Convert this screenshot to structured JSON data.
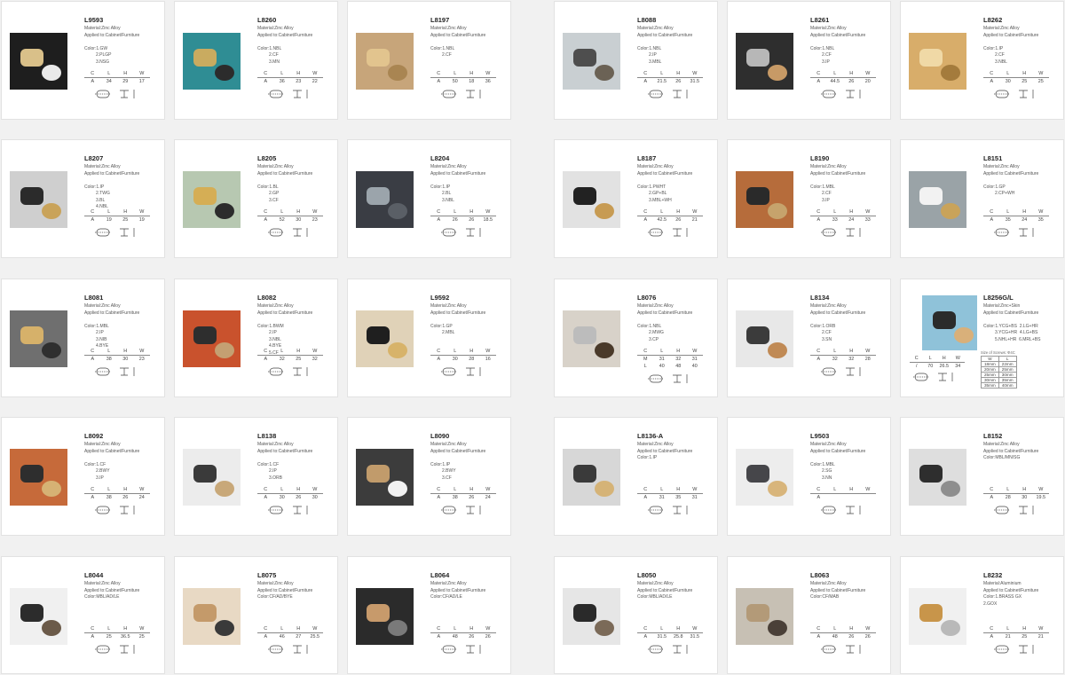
{
  "products": [
    {
      "code": "L9593",
      "lines": [
        "Material:Zinc Alloy",
        "Applied to:Cabinet/Furniture",
        "",
        "Color:1.GW",
        "2.PLGP",
        "3.NSG"
      ],
      "header": [
        "C",
        "L",
        "H",
        "W"
      ],
      "rows": [
        [
          "A",
          "34",
          "29",
          "17"
        ]
      ],
      "bg": "#1e1e1e",
      "k": "#d9c089",
      "k2": "#eaeaea"
    },
    {
      "code": "L8260",
      "lines": [
        "Material:Zinc Alloy",
        "Applied to:Cabinet/Furniture",
        "",
        "Color:1.NBL",
        "2.CF",
        "3.MN"
      ],
      "header": [
        "C",
        "L",
        "H",
        "W"
      ],
      "rows": [
        [
          "A",
          "36",
          "23",
          "22"
        ]
      ],
      "bg": "#2f8d94",
      "k": "#c9ab60",
      "k2": "#2c2c2c"
    },
    {
      "code": "L8197",
      "lines": [
        "Material:Zinc Alloy",
        "Applied to:Cabinet/Furniture",
        "",
        "Color:1.NBL",
        "2.CF"
      ],
      "header": [
        "C",
        "L",
        "H",
        "W"
      ],
      "rows": [
        [
          "A",
          "50",
          "18",
          "36"
        ]
      ],
      "bg": "#c7a57a",
      "k": "#e2c48e",
      "k2": "#a98552"
    },
    {
      "code": "L8088",
      "lines": [
        "Material:Zinc Alloy",
        "Applied to:Cabinet/Furniture",
        "",
        "Color:1.NBL",
        "2.IP",
        "3.MBL"
      ],
      "header": [
        "C",
        "L",
        "H",
        "W"
      ],
      "rows": [
        [
          "A",
          "21.5",
          "26",
          "31.5"
        ]
      ],
      "bg": "#c9cfd2",
      "k": "#4e4e4e",
      "k2": "#6b6255"
    },
    {
      "code": "L8261",
      "lines": [
        "Material:Zinc Alloy",
        "Applied to:Cabinet/Furniture",
        "",
        "Color:1.NBL",
        "2.CF",
        "3.IP"
      ],
      "header": [
        "C",
        "L",
        "H",
        "W"
      ],
      "rows": [
        [
          "A",
          "44.5",
          "26",
          "20"
        ]
      ],
      "bg": "#2e2e2e",
      "k": "#b7b7b7",
      "k2": "#c79a66"
    },
    {
      "code": "L8262",
      "lines": [
        "Material:Zinc Alloy",
        "Applied to:Cabinet/Furniture",
        "",
        "Color:1.IP",
        "2.CF",
        "3.NBL"
      ],
      "header": [
        "C",
        "L",
        "H",
        "W"
      ],
      "rows": [
        [
          "A",
          "30",
          "25",
          "25"
        ]
      ],
      "bg": "#d8ad6a",
      "k": "#f0d9a6",
      "k2": "#a47b3c"
    },
    {
      "code": "L8207",
      "lines": [
        "Material:Zinc Alloy",
        "Applied to:Cabinet/Furniture",
        "",
        "Color:1.IP",
        "2.TWG",
        "3.BL",
        "4.NBL"
      ],
      "header": [
        "C",
        "L",
        "H",
        "W"
      ],
      "rows": [
        [
          "A",
          "19",
          "25",
          "19"
        ]
      ],
      "bg": "#cfcfcf",
      "k": "#2b2b2b",
      "k2": "#c9a35a"
    },
    {
      "code": "L8205",
      "lines": [
        "Material:Zinc Alloy",
        "Applied to:Cabinet/Furniture",
        "",
        "Color:1.BL",
        "2.GP",
        "3.CF"
      ],
      "header": [
        "C",
        "L",
        "H",
        "W"
      ],
      "rows": [
        [
          "A",
          "52",
          "30",
          "23"
        ]
      ],
      "bg": "#b7c8b1",
      "k": "#d5ae55",
      "k2": "#2c2c2c"
    },
    {
      "code": "L8204",
      "lines": [
        "Material:Zinc Alloy",
        "Applied to:Cabinet/Furniture",
        "",
        "Color:1.IP",
        "2.BL",
        "3.NBL"
      ],
      "header": [
        "C",
        "L",
        "H",
        "W"
      ],
      "rows": [
        [
          "A",
          "26",
          "26",
          "18.5"
        ]
      ],
      "bg": "#3a3d44",
      "k": "#9ba4ab",
      "k2": "#5a5f66"
    },
    {
      "code": "L8187",
      "lines": [
        "Material:Zinc Alloy",
        "Applied to:Cabinet/Furniture",
        "",
        "Color:1.PWHT",
        "2.GP+BL",
        "3.MBL+WH"
      ],
      "header": [
        "C",
        "L",
        "H",
        "W"
      ],
      "rows": [
        [
          "A",
          "42.5",
          "26",
          "21"
        ]
      ],
      "bg": "#e2e2e2",
      "k": "#222222",
      "k2": "#c79b53"
    },
    {
      "code": "L8190",
      "lines": [
        "Material:Zinc Alloy",
        "Applied to:Cabinet/Furniture",
        "",
        "Color:1.MBL",
        "2.CF",
        "3.IP"
      ],
      "header": [
        "C",
        "L",
        "H",
        "W"
      ],
      "rows": [
        [
          "A",
          "33",
          "24",
          "33"
        ]
      ],
      "bg": "#b66c3b",
      "k": "#2a2a2a",
      "k2": "#c6a36c"
    },
    {
      "code": "L8151",
      "lines": [
        "Material:Zinc Alloy",
        "Applied to:Cabinet/Furniture",
        "",
        "Color:1.GP",
        "2.CP+WH"
      ],
      "header": [
        "C",
        "L",
        "H",
        "W"
      ],
      "rows": [
        [
          "A",
          "35",
          "24",
          "35"
        ]
      ],
      "bg": "#9aa3a7",
      "k": "#f2f2f2",
      "k2": "#c9a35a"
    },
    {
      "code": "L8081",
      "lines": [
        "Material:Zinc Alloy",
        "Applied to:Cabinet/Furniture",
        "",
        "Color:1.MBL",
        "2.IP",
        "3.NIB",
        "4.BYE"
      ],
      "header": [
        "C",
        "L",
        "H",
        "W"
      ],
      "rows": [
        [
          "A",
          "38",
          "30",
          "23"
        ]
      ],
      "bg": "#6f6f6f",
      "k": "#d6b16a",
      "k2": "#2f2f2f"
    },
    {
      "code": "L8082",
      "lines": [
        "Material:Zinc Alloy",
        "Applied to:Cabinet/Furniture",
        "",
        "Color:1.BWM",
        "2.IP",
        "3.NBL",
        "4.BYE",
        "5.CF"
      ],
      "header": [
        "C",
        "L",
        "H",
        "W"
      ],
      "rows": [
        [
          "A",
          "32",
          "25",
          "32"
        ]
      ],
      "bg": "#c9522d",
      "k": "#2e2e2e",
      "k2": "#c4a072"
    },
    {
      "code": "L9592",
      "lines": [
        "Material:Zinc Alloy",
        "Applied to:Cabinet/Furniture",
        "",
        "Color:1.GP",
        "2.MBL"
      ],
      "header": [
        "C",
        "L",
        "H",
        "W"
      ],
      "rows": [
        [
          "A",
          "30",
          "28",
          "16"
        ]
      ],
      "bg": "#e0d2b8",
      "k": "#1f1f1f",
      "k2": "#d7b36a"
    },
    {
      "code": "L8076",
      "lines": [
        "Material:Zinc Alloy",
        "Applied to:Cabinet/Furniture",
        "",
        "Color:1.NBL",
        "2.MWG",
        "3.CP"
      ],
      "header": [
        "C",
        "L",
        "H",
        "W"
      ],
      "rows": [
        [
          "M",
          "31",
          "32",
          "31"
        ],
        [
          "L",
          "40",
          "48",
          "40"
        ]
      ],
      "bg": "#d8d2c9",
      "k": "#bcbcbc",
      "k2": "#4a3a2a"
    },
    {
      "code": "L8134",
      "lines": [
        "Material:Zinc Alloy",
        "Applied to:Cabinet/Furniture",
        "",
        "Color:1.ORB",
        "2.CF",
        "3.SN"
      ],
      "header": [
        "C",
        "L",
        "H",
        "W"
      ],
      "rows": [
        [
          "A",
          "32",
          "32",
          "28"
        ]
      ],
      "bg": "#e8e8e8",
      "k": "#3b3b3b",
      "k2": "#c08a55"
    },
    {
      "code": "L8256G/L",
      "lines": [
        "Material:Zinc+Skin",
        "Applied to:Cabinet/Furniture",
        "",
        "Color:1.YCG+BS  2.LG+HR",
        "3.YCG+HR  4.LG+BS",
        "5.NHL+HR  6.MRL+BS"
      ],
      "header": [
        "C",
        "L",
        "H",
        "W"
      ],
      "rows": [
        [
          "/",
          "70",
          "26.5",
          "34"
        ]
      ],
      "bg": "#8fc2d9",
      "k": "#2b2b2b",
      "k2": "#d9b07a",
      "extra": {
        "caption": "Size of Screws: Φ4C",
        "head": [
          "W",
          "L"
        ],
        "rows": [
          [
            "18mm",
            "22mm"
          ],
          [
            "20mm",
            "25mm"
          ],
          [
            "25mm",
            "30mm"
          ],
          [
            "30mm",
            "35mm"
          ],
          [
            "35mm",
            "40mm"
          ]
        ]
      }
    },
    {
      "code": "L8092",
      "lines": [
        "Material:Zinc Alloy",
        "Applied to:Cabinet/Furniture",
        "",
        "Color:1.CF",
        "2.BWY",
        "3.IP"
      ],
      "header": [
        "C",
        "L",
        "H",
        "W"
      ],
      "rows": [
        [
          "A",
          "38",
          "26",
          "24"
        ]
      ],
      "bg": "#c66a3a",
      "k": "#2e2e2e",
      "k2": "#d6b274"
    },
    {
      "code": "L8138",
      "lines": [
        "Material:Zinc Alloy",
        "Applied to:Cabinet/Furniture",
        "",
        "Color:1.CF",
        "2.IP",
        "3.ORB"
      ],
      "header": [
        "C",
        "L",
        "H",
        "W"
      ],
      "rows": [
        [
          "A",
          "30",
          "26",
          "30"
        ]
      ],
      "bg": "#ececec",
      "k": "#3a3a3a",
      "k2": "#c8a879"
    },
    {
      "code": "L8090",
      "lines": [
        "Material:Zinc Alloy",
        "Applied to:Cabinet/Furniture",
        "",
        "Color:1.IP",
        "2.BWY",
        "3.CF"
      ],
      "header": [
        "C",
        "L",
        "H",
        "W"
      ],
      "rows": [
        [
          "A",
          "38",
          "26",
          "24"
        ]
      ],
      "bg": "#3c3c3c",
      "k": "#c19b6b",
      "k2": "#f2f2f2"
    },
    {
      "code": "L8136-A",
      "lines": [
        "Material:Zinc Alloy",
        "Applied to:Cabinet/Furniture",
        "Color:1.IP"
      ],
      "header": [
        "C",
        "L",
        "H",
        "W"
      ],
      "rows": [
        [
          "A",
          "31",
          "35",
          "31"
        ]
      ],
      "bg": "#d7d7d7",
      "k": "#3a3a3a",
      "k2": "#d5b377"
    },
    {
      "code": "L9503",
      "lines": [
        "Material:Zinc Alloy",
        "Applied to:Cabinet/Furniture",
        "",
        "Color:1.MBL",
        "2.SG",
        "3.NN"
      ],
      "header": [
        "C",
        "L",
        "H",
        "W"
      ],
      "rows": [
        [
          "A",
          "",
          "",
          ""
        ]
      ],
      "bg": "#ededed",
      "k": "#46464a",
      "k2": "#d8b57b"
    },
    {
      "code": "L8152",
      "lines": [
        "Material:Zinc Alloy",
        "Applied to:Cabinet/Furniture",
        "Color:MBL/MN/SG"
      ],
      "header": [
        "C",
        "L",
        "H",
        "W"
      ],
      "rows": [
        [
          "A",
          "28",
          "30",
          "19.5"
        ]
      ],
      "bg": "#dedede",
      "k": "#2e2e2e",
      "k2": "#8e8e8e"
    },
    {
      "code": "L8044",
      "lines": [
        "Material:Zinc Alloy",
        "Applied to:Cabinet/Furniture",
        "Color:MBL/AD/LE"
      ],
      "header": [
        "C",
        "L",
        "H",
        "W"
      ],
      "rows": [
        [
          "A",
          "25",
          "36.5",
          "25"
        ]
      ],
      "bg": "#f0f0f0",
      "k": "#2c2c2c",
      "k2": "#6b5a49"
    },
    {
      "code": "L8075",
      "lines": [
        "Material:Zinc Alloy",
        "Applied to:Cabinet/Furniture",
        "Color:CF/AD/BYE"
      ],
      "header": [
        "C",
        "L",
        "H",
        "W"
      ],
      "rows": [
        [
          "A",
          "46",
          "27",
          "25.5"
        ]
      ],
      "bg": "#e8d9c4",
      "k": "#c49a6a",
      "k2": "#3a3a3a"
    },
    {
      "code": "L8064",
      "lines": [
        "Material:Zinc Alloy",
        "Applied to:Cabinet/Furniture",
        "Color:CF/AD/LE"
      ],
      "header": [
        "C",
        "L",
        "H",
        "W"
      ],
      "rows": [
        [
          "A",
          "48",
          "26",
          "26"
        ]
      ],
      "bg": "#2b2b2b",
      "k": "#c79a6b",
      "k2": "#7a7a7a"
    },
    {
      "code": "L8050",
      "lines": [
        "Material:Zinc Alloy",
        "Applied to:Cabinet/Furniture",
        "Color:MBL/AD/LE"
      ],
      "header": [
        "C",
        "L",
        "H",
        "W"
      ],
      "rows": [
        [
          "A",
          "31.5",
          "25.8",
          "31.5"
        ]
      ],
      "bg": "#e6e6e6",
      "k": "#2a2a2a",
      "k2": "#7b6a58"
    },
    {
      "code": "L8063",
      "lines": [
        "Material:Zinc Alloy",
        "Applied to:Cabinet/Furniture",
        "Color:CF/MAB"
      ],
      "header": [
        "C",
        "L",
        "H",
        "W"
      ],
      "rows": [
        [
          "A",
          "48",
          "26",
          "26"
        ]
      ],
      "bg": "#c7c0b4",
      "k": "#b39a78",
      "k2": "#4a4038"
    },
    {
      "code": "L8232",
      "lines": [
        "Material:Aluminium",
        "Applied to:Cabinet/Furniture",
        "Color:1.BRASS GX",
        "2.GOX"
      ],
      "header": [
        "C",
        "L",
        "H",
        "W"
      ],
      "rows": [
        [
          "A",
          "21",
          "25",
          "21"
        ]
      ],
      "bg": "#f0f0f0",
      "k": "#c8954a",
      "k2": "#b9b9b9"
    }
  ]
}
